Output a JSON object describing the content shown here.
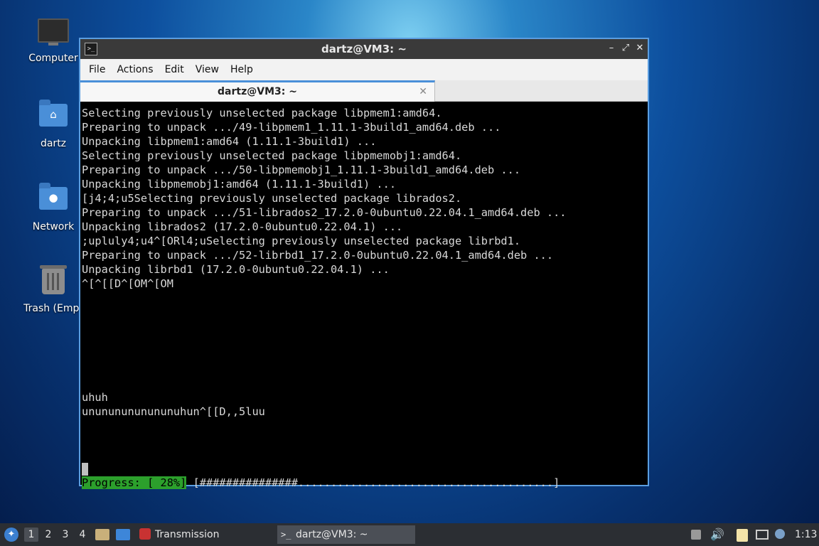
{
  "desktop": {
    "icons": [
      {
        "label": "Computer",
        "icon": "computer-icon"
      },
      {
        "label": "dartz",
        "icon": "home-folder-icon"
      },
      {
        "label": "Network",
        "icon": "network-folder-icon"
      },
      {
        "label": "Trash (Empt",
        "icon": "trash-icon"
      }
    ]
  },
  "window": {
    "title": "dartz@VM3: ~",
    "menu": [
      "File",
      "Actions",
      "Edit",
      "View",
      "Help"
    ],
    "tab_title": "dartz@VM3: ~",
    "lines": [
      "Selecting previously unselected package libpmem1:amd64.",
      "Preparing to unpack .../49-libpmem1_1.11.1-3build1_amd64.deb ...",
      "Unpacking libpmem1:amd64 (1.11.1-3build1) ...",
      "Selecting previously unselected package libpmemobj1:amd64.",
      "Preparing to unpack .../50-libpmemobj1_1.11.1-3build1_amd64.deb ...",
      "Unpacking libpmemobj1:amd64 (1.11.1-3build1) ...",
      "[j4;4;u5Selecting previously unselected package librados2.",
      "Preparing to unpack .../51-librados2_17.2.0-0ubuntu0.22.04.1_amd64.deb ...",
      "Unpacking librados2 (17.2.0-0ubuntu0.22.04.1) ...",
      ";upluly4;u4^[ORl4;uSelecting previously unselected package librbd1.",
      "Preparing to unpack .../52-librbd1_17.2.0-0ubuntu0.22.04.1_amd64.deb ...",
      "Unpacking librbd1 (17.2.0-0ubuntu0.22.04.1) ...",
      "^[^[[D^[OM^[OM",
      "",
      "",
      "",
      "",
      "",
      "",
      "",
      "uhuh",
      "unununununununuhun^[[D,,5luu",
      "",
      "",
      ""
    ],
    "progress_label": "Progress: [ 28%]",
    "progress_bar": " [###############.......................................]",
    "progress_value": 0.28
  },
  "taskbar": {
    "workspaces": [
      "1",
      "2",
      "3",
      "4"
    ],
    "active_workspace": "1",
    "tasks": [
      {
        "label": "Transmission",
        "icon": "transmission-icon"
      },
      {
        "label": "dartz@VM3: ~",
        "icon": "terminal-icon"
      }
    ],
    "clock": "1:13"
  },
  "colors": {
    "window_border": "#5a9de0",
    "progress_green": "#2ca02c",
    "taskbar": "#2b2e33"
  }
}
